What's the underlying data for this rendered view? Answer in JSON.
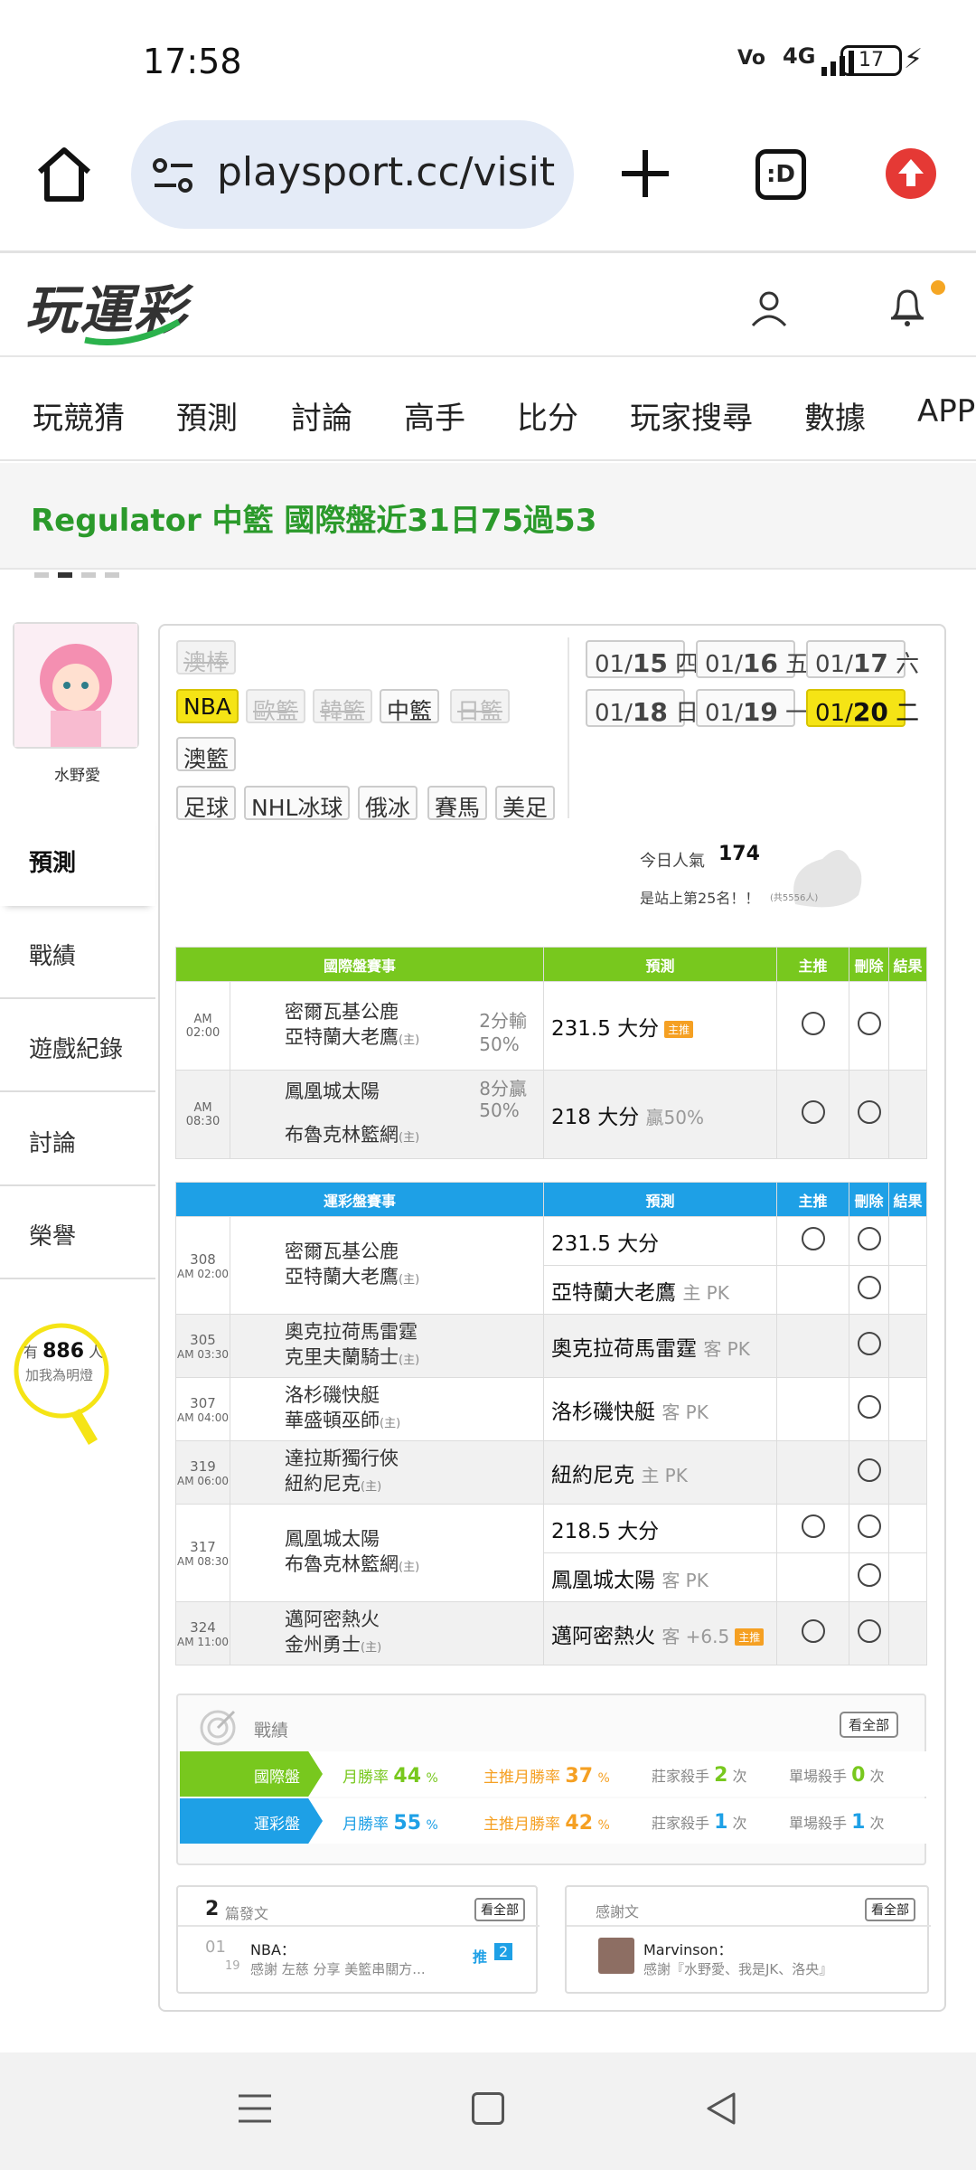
{
  "status": {
    "time": "17:58",
    "battery": "17",
    "network": "4G"
  },
  "browser": {
    "url": "playsport.cc/visit",
    "tab_label": ":D"
  },
  "site": {
    "logo": "玩運彩"
  },
  "nav": {
    "items": [
      "玩競猜",
      "預測",
      "討論",
      "高手",
      "比分",
      "玩家搜尋",
      "數據",
      "APP"
    ]
  },
  "ticker": {
    "text": "Regulator 中籃 國際盤近31日75過53"
  },
  "profile": {
    "name": "水野愛",
    "fans_prefix": "有",
    "fans_count": "886",
    "fans_suffix": "人",
    "fans_cta": "加我為明燈"
  },
  "side_tabs": [
    "預測",
    "戰績",
    "遊戲紀錄",
    "討論",
    "榮譽"
  ],
  "sports": {
    "row1": [
      "澳棒"
    ],
    "row2": [
      "NBA",
      "歐籃",
      "韓籃",
      "中籃",
      "日籃"
    ],
    "row3": [
      "澳籃"
    ],
    "row4": [
      "足球",
      "NHL冰球",
      "俄冰",
      "賽馬",
      "美足"
    ]
  },
  "dates": [
    {
      "prefix": "01/",
      "day": "15",
      "week": "四"
    },
    {
      "prefix": "01/",
      "day": "16",
      "week": "五"
    },
    {
      "prefix": "01/",
      "day": "17",
      "week": "六"
    },
    {
      "prefix": "01/",
      "day": "18",
      "week": "日"
    },
    {
      "prefix": "01/",
      "day": "19",
      "week": "一"
    },
    {
      "prefix": "01/",
      "day": "20",
      "week": "二"
    }
  ],
  "popularity": {
    "label": "今日人氣",
    "value": "174",
    "rank": "是站上第25名！！",
    "rank_note": "(共5556人)"
  },
  "intl_table": {
    "headers": [
      "國際盤賽事",
      "預測",
      "主推",
      "刪除",
      "結果"
    ],
    "rows": [
      {
        "time": "AM 02:00",
        "away": "密爾瓦基公鹿",
        "home": "亞特蘭大老鷹",
        "home_tag": "(主)",
        "odds_1": "2分輸",
        "odds_2": "50%",
        "pick": "231.5 大分",
        "pick_tag": "主推",
        "extra": ""
      },
      {
        "time": "AM 08:30",
        "away": "鳳凰城太陽",
        "home": "布魯克林籃網",
        "home_tag": "(主)",
        "odds_1": "8分贏",
        "odds_2": "50%",
        "pick": "218 大分",
        "pick_tag": "",
        "extra": "贏50%"
      }
    ]
  },
  "local_table": {
    "headers": [
      "運彩盤賽事",
      "預測",
      "主推",
      "刪除",
      "結果"
    ],
    "games": [
      {
        "no": "308",
        "time": "AM 02:00",
        "away": "密爾瓦基公鹿",
        "home": "亞特蘭大老鷹",
        "home_tag": "(主)",
        "picks": [
          {
            "text": "231.5 大分",
            "note": "",
            "main": true
          },
          {
            "text": "亞特蘭大老鷹",
            "note": "主 PK",
            "main": false
          }
        ]
      },
      {
        "no": "305",
        "time": "AM 03:30",
        "away": "奧克拉荷馬雷霆",
        "home": "克里夫蘭騎士",
        "home_tag": "(主)",
        "picks": [
          {
            "text": "奧克拉荷馬雷霆",
            "note": "客 PK",
            "main": false
          }
        ]
      },
      {
        "no": "307",
        "time": "AM 04:00",
        "away": "洛杉磯快艇",
        "home": "華盛頓巫師",
        "home_tag": "(主)",
        "picks": [
          {
            "text": "洛杉磯快艇",
            "note": "客 PK",
            "main": false
          }
        ]
      },
      {
        "no": "319",
        "time": "AM 06:00",
        "away": "達拉斯獨行俠",
        "home": "紐約尼克",
        "home_tag": "(主)",
        "picks": [
          {
            "text": "紐約尼克",
            "note": "主 PK",
            "main": false
          }
        ]
      },
      {
        "no": "317",
        "time": "AM 08:30",
        "away": "鳳凰城太陽",
        "home": "布魯克林籃網",
        "home_tag": "(主)",
        "picks": [
          {
            "text": "218.5 大分",
            "note": "",
            "main": true
          },
          {
            "text": "鳳凰城太陽",
            "note": "客 PK",
            "main": false
          }
        ]
      },
      {
        "no": "324",
        "time": "AM 11:00",
        "away": "邁阿密熱火",
        "home": "金州勇士",
        "home_tag": "(主)",
        "picks": [
          {
            "text": "邁阿密熱火",
            "note": "客 +6.5",
            "main": true,
            "tag": "主推"
          }
        ]
      }
    ]
  },
  "record": {
    "title": "戰績",
    "view_all": "看全部",
    "rows": [
      {
        "label": "國際盤",
        "win_label": "月勝率",
        "win": "44",
        "main_label": "主推月勝率",
        "main": "37",
        "killer_label": "莊家殺手",
        "killer": "2",
        "single_label": "單場殺手",
        "single": "0",
        "unit": "次",
        "pct": "%"
      },
      {
        "label": "運彩盤",
        "win_label": "月勝率",
        "win": "55",
        "main_label": "主推月勝率",
        "main": "42",
        "killer_label": "莊家殺手",
        "killer": "1",
        "single_label": "單場殺手",
        "single": "1",
        "unit": "次",
        "pct": "%"
      }
    ]
  },
  "posts": {
    "count": "2",
    "label": "篇發文",
    "view_all": "看全部",
    "date_m": "01",
    "date_d": "19",
    "category": "NBA：",
    "snippet": "感謝 左慈 分享 美籃串關方...",
    "push_label": "推",
    "push_count": "2"
  },
  "thanks": {
    "label": "感謝文",
    "view_all": "看全部",
    "user": "Marvinson：",
    "text": "感謝『水野愛、我是JK、洛央』"
  },
  "colors": {
    "green": "#78c81e",
    "blue": "#1ea0e6",
    "brand_green": "#2b9a2b",
    "highlight": "#f5e415"
  }
}
